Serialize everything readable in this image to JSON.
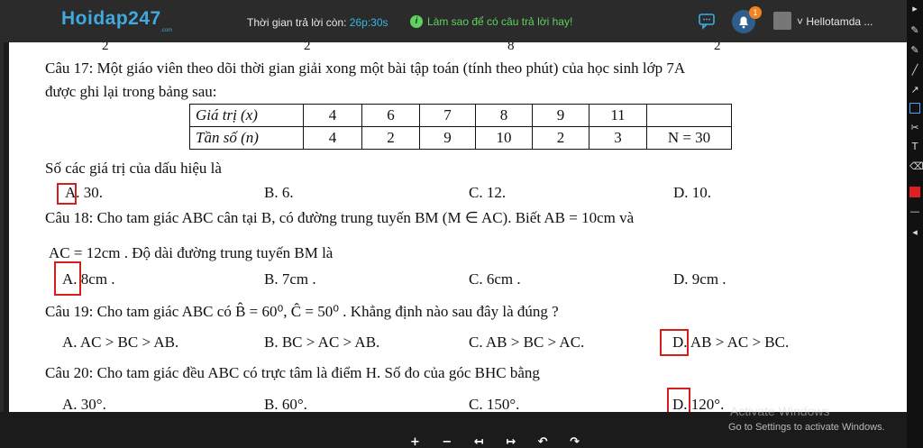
{
  "header": {
    "logo": "Hoidap247",
    "logo_sub": ".com",
    "timer_label": "Thời gian trả lời còn:",
    "timer_value": "26p:30s",
    "help_icon": "i",
    "help_text": "Làm sao để có câu trả lời hay!",
    "notif_count": "1",
    "username": "Hellotamda ..."
  },
  "doc": {
    "top_fractions": [
      "2",
      "2",
      "8",
      "2"
    ],
    "q17": {
      "line1": "Câu 17: Một giáo viên theo dõi thời gian giải xong một bài tập toán (tính theo phút) của học sinh lớp 7A",
      "line2": "được ghi lại trong bảng sau:",
      "table": {
        "row1_header": "Giá trị (x)",
        "row1": [
          "4",
          "6",
          "7",
          "8",
          "9",
          "11",
          ""
        ],
        "row2_header": "Tần số (n)",
        "row2": [
          "4",
          "2",
          "9",
          "10",
          "2",
          "3",
          "N = 30"
        ]
      },
      "question": "Số các giá trị của dấu hiệu là",
      "options": {
        "a": "A. 30.",
        "b": "B. 6.",
        "c": "C. 12.",
        "d": "D. 10."
      }
    },
    "q18": {
      "line1": "Câu 18: Cho tam giác ABC cân tại B, có đường trung tuyến BM (M ∈ AC). Biết AB = 10cm và",
      "line2": "AC = 12cm . Độ dài đường trung tuyến BM là",
      "options": {
        "a": "A. 8cm .",
        "b": "B. 7cm .",
        "c": "C. 6cm .",
        "d": "D. 9cm ."
      }
    },
    "q19": {
      "line1": "Câu 19: Cho tam giác ABC có B̂ = 60⁰, Ĉ = 50⁰ . Khẳng định nào sau đây là đúng ?",
      "options": {
        "a": "A. AC > BC > AB.",
        "b": "B. BC > AC > AB.",
        "c": "C. AB > BC > AC.",
        "d": "D. AB > AC > BC."
      }
    },
    "q20": {
      "line1": "Câu 20: Cho tam giác đều ABC có trực tâm là điểm H. Số đo của góc BHC bằng",
      "options": {
        "a": "A. 30°.",
        "b": "B. 60°.",
        "c": "C. 150°.",
        "d": "D. 120°."
      }
    }
  },
  "watermark": {
    "line1": "Activate Windows",
    "line2": "Go to Settings to activate Windows."
  },
  "bottom_controls": "+ − ↤ ↦ ↶ ↷",
  "colors": {
    "topbar": "#2b2b2b",
    "logo": "#3fa9e0",
    "timer": "#36b7e6",
    "help": "#5ed35e",
    "mark_box": "#d41f1f",
    "badge": "#f58220"
  }
}
